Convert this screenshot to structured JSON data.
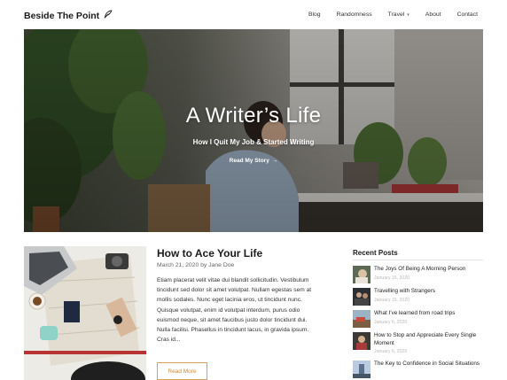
{
  "site": {
    "title": "Beside The Point"
  },
  "nav": {
    "items": [
      {
        "label": "Blog"
      },
      {
        "label": "Randomness"
      },
      {
        "label": "Travel"
      },
      {
        "label": "About"
      },
      {
        "label": "Contact"
      }
    ]
  },
  "hero": {
    "title": "A Writer’s Life",
    "subtitle": "How I Quit My Job & Started Writing",
    "link": "Read My Story"
  },
  "post": {
    "title": "How to Ace Your Life",
    "date": "March 21, 2020",
    "by": "by",
    "author": "Jane Doe",
    "excerpt": "Etiam placerat velit vitae dui blandit sollicitudin. Vestibulum tincidunt sed dolor sit amet volutpat. Nullam egestas sem at mollis sodales. Nunc eget lacinia eros, ut tincidunt nunc. Quisque volutpat, enim id volutpat interdum, purus odio euismod neque, sit amet faucibus justo dolor tincidunt dui. Nulla facilisi. Phasellus in tincidunt lacus, in gravida ipsum. Cras id...",
    "read_more": "Read More"
  },
  "sidebar": {
    "heading": "Recent Posts",
    "posts": [
      {
        "title": "The Joys Of Being A Morning Person",
        "date": "January 15, 2020"
      },
      {
        "title": "Travelling with Strangers",
        "date": "January 15, 2020"
      },
      {
        "title": "What I’ve learned from road trips",
        "date": "January 6, 2020"
      },
      {
        "title": "How to Stop and Appreciate Every Single Moment",
        "date": "January 6, 2020"
      },
      {
        "title": "The Key to Confidence in Social Situations",
        "date": ""
      }
    ]
  },
  "colors": {
    "accent": "#c98b3f",
    "date_gray": "#b9b9b9"
  }
}
